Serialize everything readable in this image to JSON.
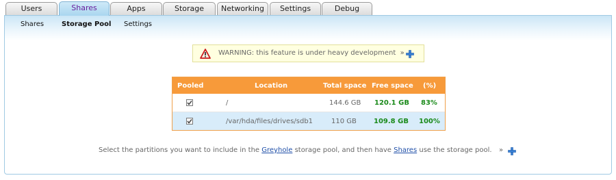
{
  "tabs": [
    {
      "label": "Users"
    },
    {
      "label": "Shares"
    },
    {
      "label": "Apps"
    },
    {
      "label": "Storage"
    },
    {
      "label": "Networking"
    },
    {
      "label": "Settings"
    },
    {
      "label": "Debug"
    }
  ],
  "active_tab": "Shares",
  "subnav": [
    {
      "label": "Shares"
    },
    {
      "label": "Storage Pool"
    },
    {
      "label": "Settings"
    }
  ],
  "active_subnav": "Storage Pool",
  "warning": {
    "icon": "warning-triangle-icon",
    "text": "WARNING: this feature is under heavy development",
    "more": "»",
    "expand_icon": "plus-icon"
  },
  "pool_table": {
    "columns": [
      "Pooled",
      "Location",
      "Total space",
      "Free space",
      "(%)"
    ],
    "rows": [
      {
        "pooled": true,
        "location": "/",
        "total": "144.6 GB",
        "free": "120.1 GB",
        "pct": "83%"
      },
      {
        "pooled": true,
        "location": "/var/hda/files/drives/sdb1",
        "total": "110 GB",
        "free": "109.8 GB",
        "pct": "100%"
      }
    ]
  },
  "help": {
    "part1": "Select the partitions you want to include in the",
    "link1": "Greyhole",
    "part2": "storage pool, and then have",
    "link2": "Shares",
    "part3": "use the storage pool.",
    "more": "»"
  },
  "colors": {
    "header_orange": "#f79a3a",
    "row_alt_blue": "#d8ecfa",
    "free_green": "#1a8a1a",
    "active_tab_text": "#6b1e9c",
    "link_blue": "#1f4fa8"
  }
}
